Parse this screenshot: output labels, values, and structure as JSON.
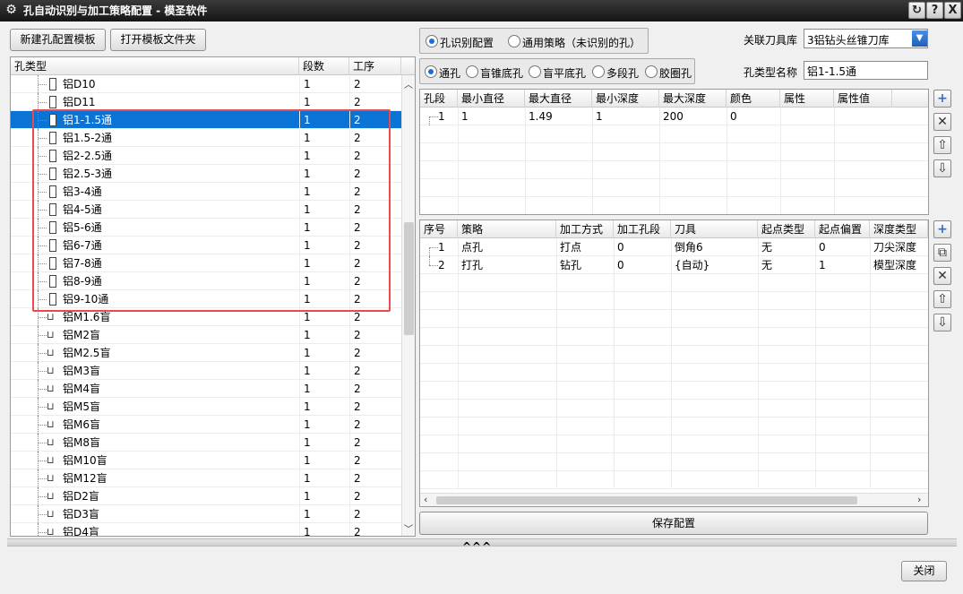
{
  "window": {
    "title": "孔自动识别与加工策略配置 - 模圣软件",
    "buttons": [
      "?",
      "X"
    ]
  },
  "toolbar": {
    "new_template": "新建孔配置模板",
    "open_folder": "打开模板文件夹"
  },
  "left_table": {
    "columns": [
      "孔类型",
      "段数",
      "工序"
    ],
    "rows": [
      {
        "name": "铝D10",
        "seg": "1",
        "proc": "2",
        "icon": "doc"
      },
      {
        "name": "铝D11",
        "seg": "1",
        "proc": "2",
        "icon": "doc"
      },
      {
        "name": "铝1-1.5通",
        "seg": "1",
        "proc": "2",
        "icon": "doc"
      },
      {
        "name": "铝1.5-2通",
        "seg": "1",
        "proc": "2",
        "icon": "doc"
      },
      {
        "name": "铝2-2.5通",
        "seg": "1",
        "proc": "2",
        "icon": "doc"
      },
      {
        "name": "铝2.5-3通",
        "seg": "1",
        "proc": "2",
        "icon": "doc"
      },
      {
        "name": "铝3-4通",
        "seg": "1",
        "proc": "2",
        "icon": "doc"
      },
      {
        "name": "铝4-5通",
        "seg": "1",
        "proc": "2",
        "icon": "doc"
      },
      {
        "name": "铝5-6通",
        "seg": "1",
        "proc": "2",
        "icon": "doc"
      },
      {
        "name": "铝6-7通",
        "seg": "1",
        "proc": "2",
        "icon": "doc"
      },
      {
        "name": "铝7-8通",
        "seg": "1",
        "proc": "2",
        "icon": "doc"
      },
      {
        "name": "铝8-9通",
        "seg": "1",
        "proc": "2",
        "icon": "doc"
      },
      {
        "name": "铝9-10通",
        "seg": "1",
        "proc": "2",
        "icon": "doc"
      },
      {
        "name": "铝M1.6盲",
        "seg": "1",
        "proc": "2",
        "icon": "screw"
      },
      {
        "name": "铝M2盲",
        "seg": "1",
        "proc": "2",
        "icon": "screw"
      },
      {
        "name": "铝M2.5盲",
        "seg": "1",
        "proc": "2",
        "icon": "screw"
      },
      {
        "name": "铝M3盲",
        "seg": "1",
        "proc": "2",
        "icon": "screw"
      },
      {
        "name": "铝M4盲",
        "seg": "1",
        "proc": "2",
        "icon": "screw"
      },
      {
        "name": "铝M5盲",
        "seg": "1",
        "proc": "2",
        "icon": "screw"
      },
      {
        "name": "铝M6盲",
        "seg": "1",
        "proc": "2",
        "icon": "screw"
      },
      {
        "name": "铝M8盲",
        "seg": "1",
        "proc": "2",
        "icon": "screw"
      },
      {
        "name": "铝M10盲",
        "seg": "1",
        "proc": "2",
        "icon": "screw"
      },
      {
        "name": "铝M12盲",
        "seg": "1",
        "proc": "2",
        "icon": "screw"
      },
      {
        "name": "铝D2盲",
        "seg": "1",
        "proc": "2",
        "icon": "screw"
      },
      {
        "name": "铝D3盲",
        "seg": "1",
        "proc": "2",
        "icon": "screw"
      },
      {
        "name": "铝D4盲",
        "seg": "1",
        "proc": "2",
        "icon": "screw"
      }
    ],
    "selected_index": 2,
    "highlight_color": "#e84b4b",
    "selection_color": "#0a74d6"
  },
  "config_mode": {
    "options": [
      "孔识别配置",
      "通用策略（未识别的孔）"
    ],
    "selected": 0
  },
  "hole_kind": {
    "options": [
      "通孔",
      "盲锥底孔",
      "盲平底孔",
      "多段孔",
      "胶圈孔"
    ],
    "selected": 0
  },
  "tool_library": {
    "label": "关联刀具库",
    "value": "3铝钻头丝锥刀库"
  },
  "hole_type_name": {
    "label": "孔类型名称",
    "value": "铝1-1.5通"
  },
  "segment_table": {
    "columns": [
      "孔段",
      "最小直径",
      "最大直径",
      "最小深度",
      "最大深度",
      "颜色",
      "属性",
      "属性值"
    ],
    "rows": [
      [
        "1",
        "1",
        "1.49",
        "1",
        "200",
        "0",
        "",
        ""
      ]
    ]
  },
  "strategy_table": {
    "columns": [
      "序号",
      "策略",
      "加工方式",
      "加工孔段",
      "刀具",
      "起点类型",
      "起点偏置",
      "深度类型"
    ],
    "rows": [
      [
        "1",
        "点孔",
        "打点",
        "0",
        "倒角6",
        "无",
        "0",
        "刀尖深度"
      ],
      [
        "2",
        "打孔",
        "钻孔",
        "0",
        "{自动}",
        "无",
        "1",
        "模型深度"
      ]
    ]
  },
  "save_button": "保存配置",
  "collapse_arrows": "^^^",
  "close_button": "关闭"
}
